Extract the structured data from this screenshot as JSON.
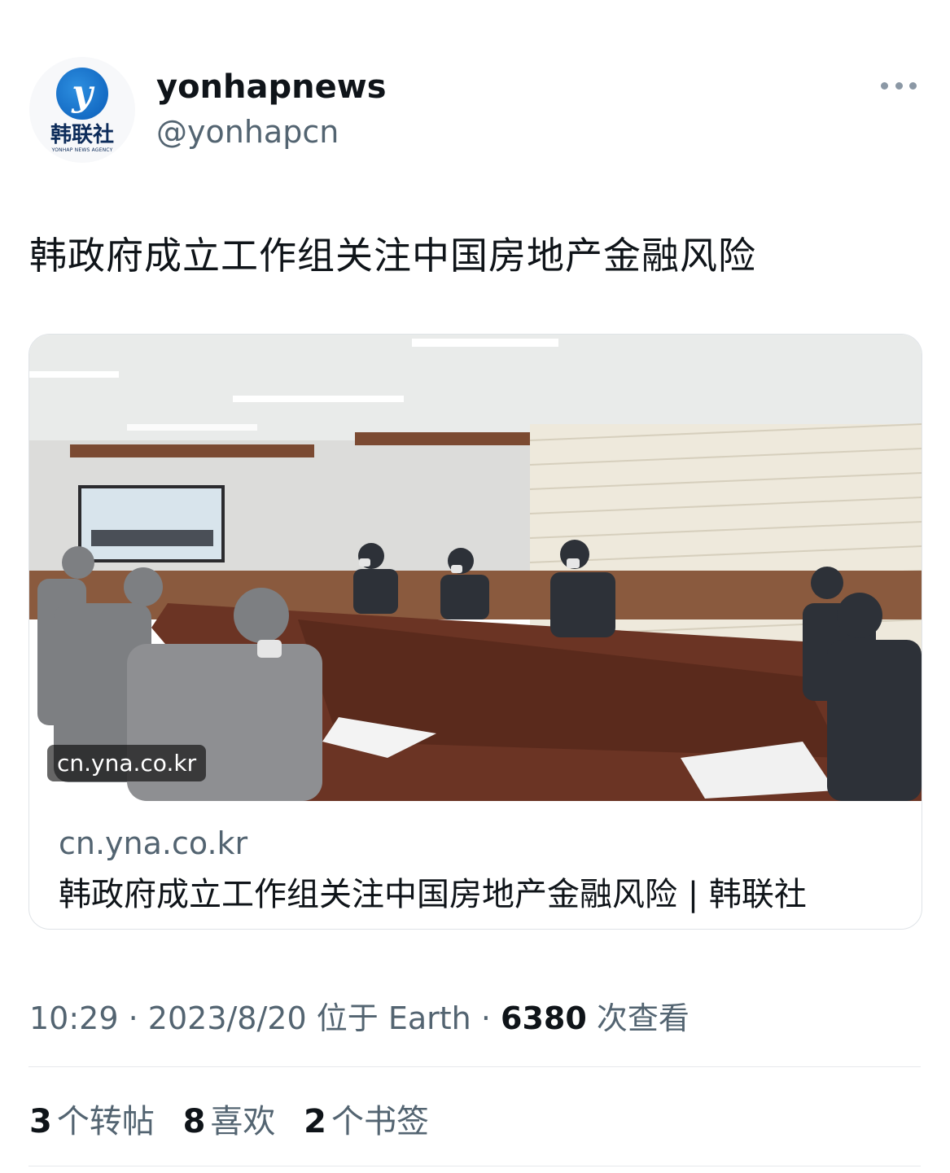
{
  "author": {
    "display_name": "yonhapnews",
    "handle": "@yonhapcn",
    "avatar_label": "韩联社",
    "avatar_sublabel": "YONHAP NEWS AGENCY",
    "avatar_icon": "yonhap-logo-icon"
  },
  "tweet": {
    "text": "韩政府成立工作组关注中国房地产金融风险"
  },
  "card": {
    "image_badge": "cn.yna.co.kr",
    "domain": "cn.yna.co.kr",
    "title": "韩政府成立工作组关注中国房地产金融风险 | 韩联社"
  },
  "meta": {
    "time": "10:29",
    "sep1": "·",
    "date": "2023/8/20",
    "location_prefix": "位于",
    "location": "Earth",
    "sep2": "·",
    "views_count": "6380",
    "views_label": "次查看"
  },
  "stats": {
    "reposts_count": "3",
    "reposts_label": "个转帖",
    "likes_count": "8",
    "likes_label": "喜欢",
    "bookmarks_count": "2",
    "bookmarks_label": "个书签"
  },
  "colors": {
    "text_primary": "#0f1419",
    "text_secondary": "#536471",
    "border": "#dfe3e7"
  }
}
